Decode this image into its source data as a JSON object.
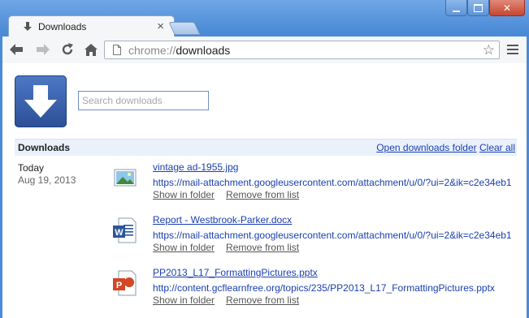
{
  "tab": {
    "title": "Downloads",
    "close_glyph": "×"
  },
  "omnibox": {
    "scheme": "chrome://",
    "host": "downloads"
  },
  "search": {
    "placeholder": "Search downloads"
  },
  "section": {
    "title": "Downloads",
    "open_folder": "Open downloads folder",
    "clear_all": "Clear all"
  },
  "date": {
    "relative": "Today",
    "full": "Aug 19, 2013"
  },
  "downloads": [
    {
      "name": "vintage ad-1955.jpg",
      "url": "https://mail-attachment.googleusercontent.com/attachment/u/0/?ui=2&ik=c2e34eb1",
      "show": "Show in folder",
      "remove": "Remove from list",
      "icon": "image-file-icon"
    },
    {
      "name": "Report - Westbrook-Parker.docx",
      "url": "https://mail-attachment.googleusercontent.com/attachment/u/0/?ui=2&ik=c2e34eb1",
      "show": "Show in folder",
      "remove": "Remove from list",
      "icon": "word-file-icon"
    },
    {
      "name": "PP2013_L17_FormattingPictures.pptx",
      "url": "http://content.gcflearnfree.org/topics/235/PP2013_L17_FormattingPictures.pptx",
      "show": "Show in folder",
      "remove": "Remove from list",
      "icon": "powerpoint-file-icon"
    }
  ],
  "colors": {
    "frame": "#4b8ad6",
    "link": "#1a3fb0",
    "section_bg": "#eaf1fb",
    "logo": "#2c4f97"
  }
}
